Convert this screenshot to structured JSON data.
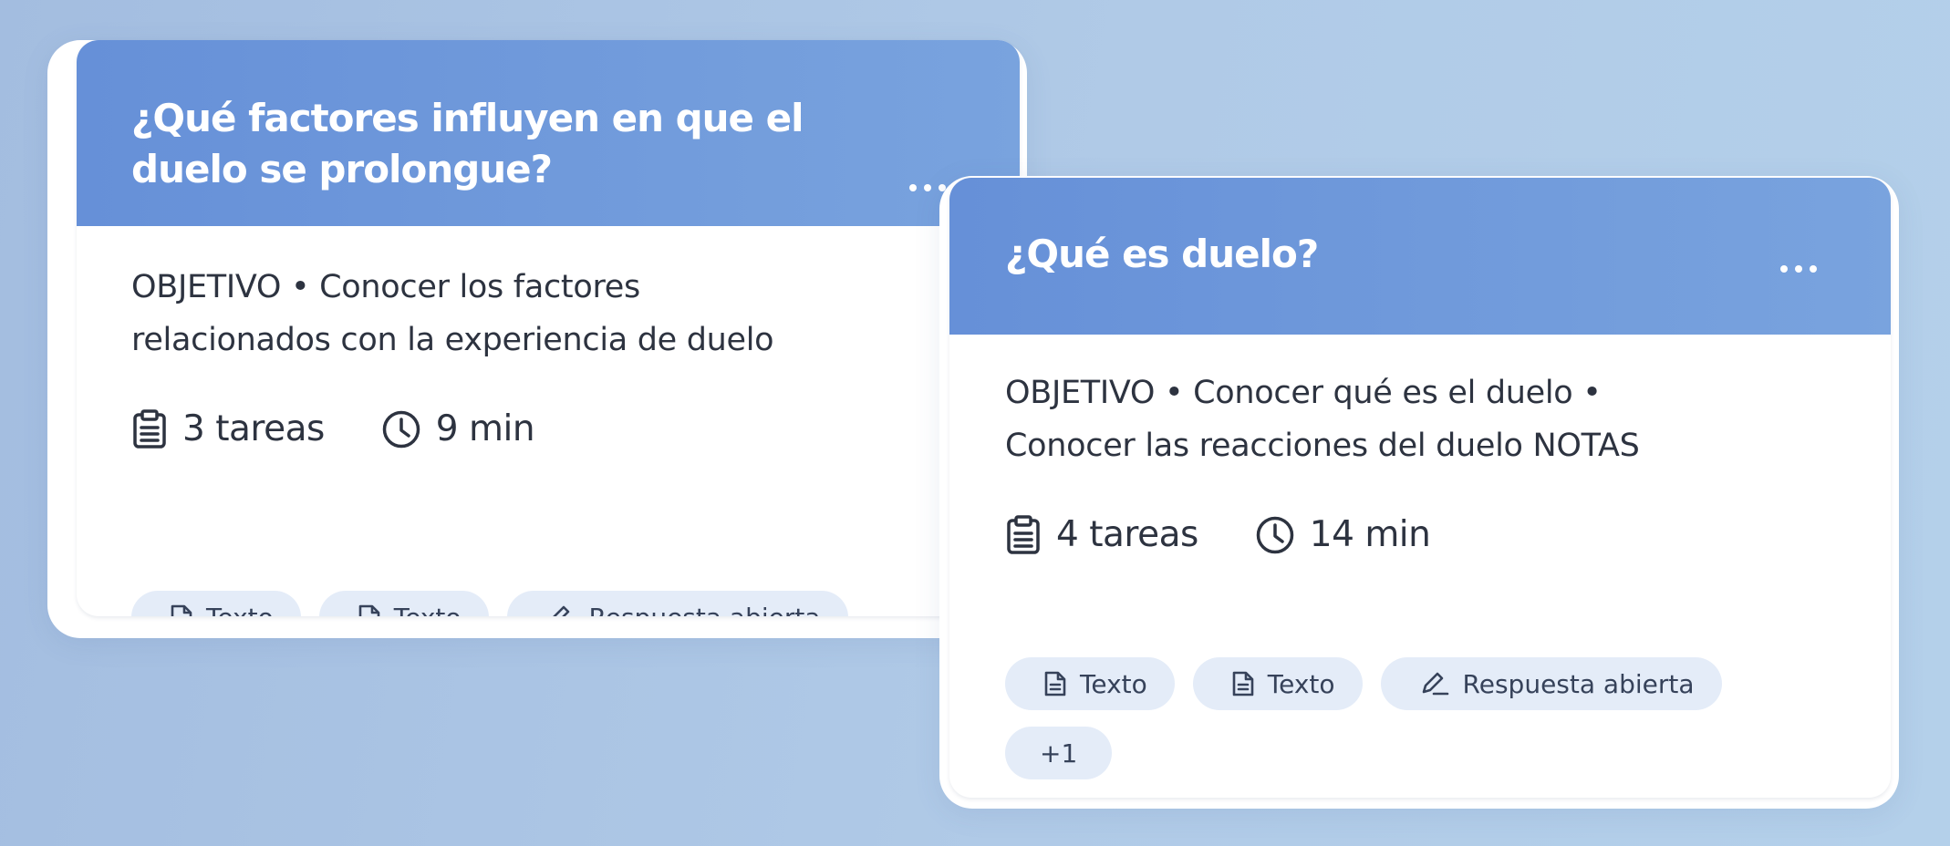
{
  "cards": [
    {
      "title_lines": [
        "¿Qué factores influyen en que el",
        "duelo se prolongue?"
      ],
      "objective_lines": [
        "OBJETIVO • Conocer los factores",
        "relacionados con la experiencia de duelo"
      ],
      "tasks_label": "3 tareas",
      "time_label": "9 min",
      "chips": [
        {
          "icon": "document-icon",
          "label": "Texto"
        },
        {
          "icon": "document-icon",
          "label": "Texto"
        },
        {
          "icon": "pencil-icon",
          "label": "Respuesta abierta"
        }
      ],
      "menu_icon": "more-options-icon"
    },
    {
      "title_lines": [
        "¿Qué es duelo?"
      ],
      "objective_lines": [
        "OBJETIVO • Conocer qué es el duelo •",
        "Conocer las reacciones del duelo NOTAS"
      ],
      "tasks_label": "4 tareas",
      "time_label": "14 min",
      "chips": [
        {
          "icon": "document-icon",
          "label": "Texto"
        },
        {
          "icon": "document-icon",
          "label": "Texto"
        },
        {
          "icon": "pencil-icon",
          "label": "Respuesta abierta"
        }
      ],
      "more_chip_label": "+1",
      "menu_icon": "more-options-icon"
    }
  ],
  "colors": {
    "header_start": "#6690d8",
    "header_end": "#79a3de",
    "chip_bg": "#e4ecf8",
    "text": "#2d3340",
    "background": "#a3bde0"
  }
}
